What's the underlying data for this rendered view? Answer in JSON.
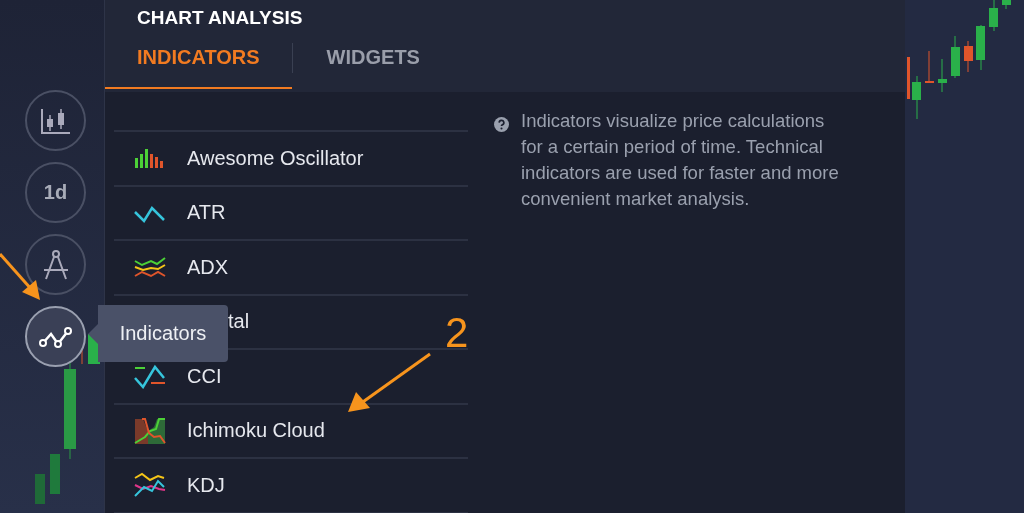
{
  "panel": {
    "title": "CHART ANALYSIS",
    "tabs": [
      {
        "label": "INDICATORS",
        "selected": true
      },
      {
        "label": "WIDGETS",
        "selected": false
      }
    ],
    "indicators": [
      {
        "label": "Awesome Oscillator",
        "kind": "bars"
      },
      {
        "label": "ATR",
        "kind": "zigzag"
      },
      {
        "label": "ADX",
        "kind": "waves"
      },
      {
        "label": "tal",
        "kind": "covered"
      },
      {
        "label": "CCI",
        "kind": "cci"
      },
      {
        "label": "Ichimoku Cloud",
        "kind": "cloud"
      },
      {
        "label": "KDJ",
        "kind": "kdj"
      }
    ],
    "description": "Indicators visualize price calculations for a certain period of time. Technical indicators are used for faster and more convenient market analysis."
  },
  "toolbar": [
    {
      "kind": "candles",
      "selected": false
    },
    {
      "kind": "text",
      "label": "1d",
      "selected": false
    },
    {
      "kind": "compass",
      "selected": false
    },
    {
      "kind": "indicators",
      "selected": true
    }
  ],
  "tooltip": "Indicators",
  "annotation": {
    "step": "2"
  }
}
